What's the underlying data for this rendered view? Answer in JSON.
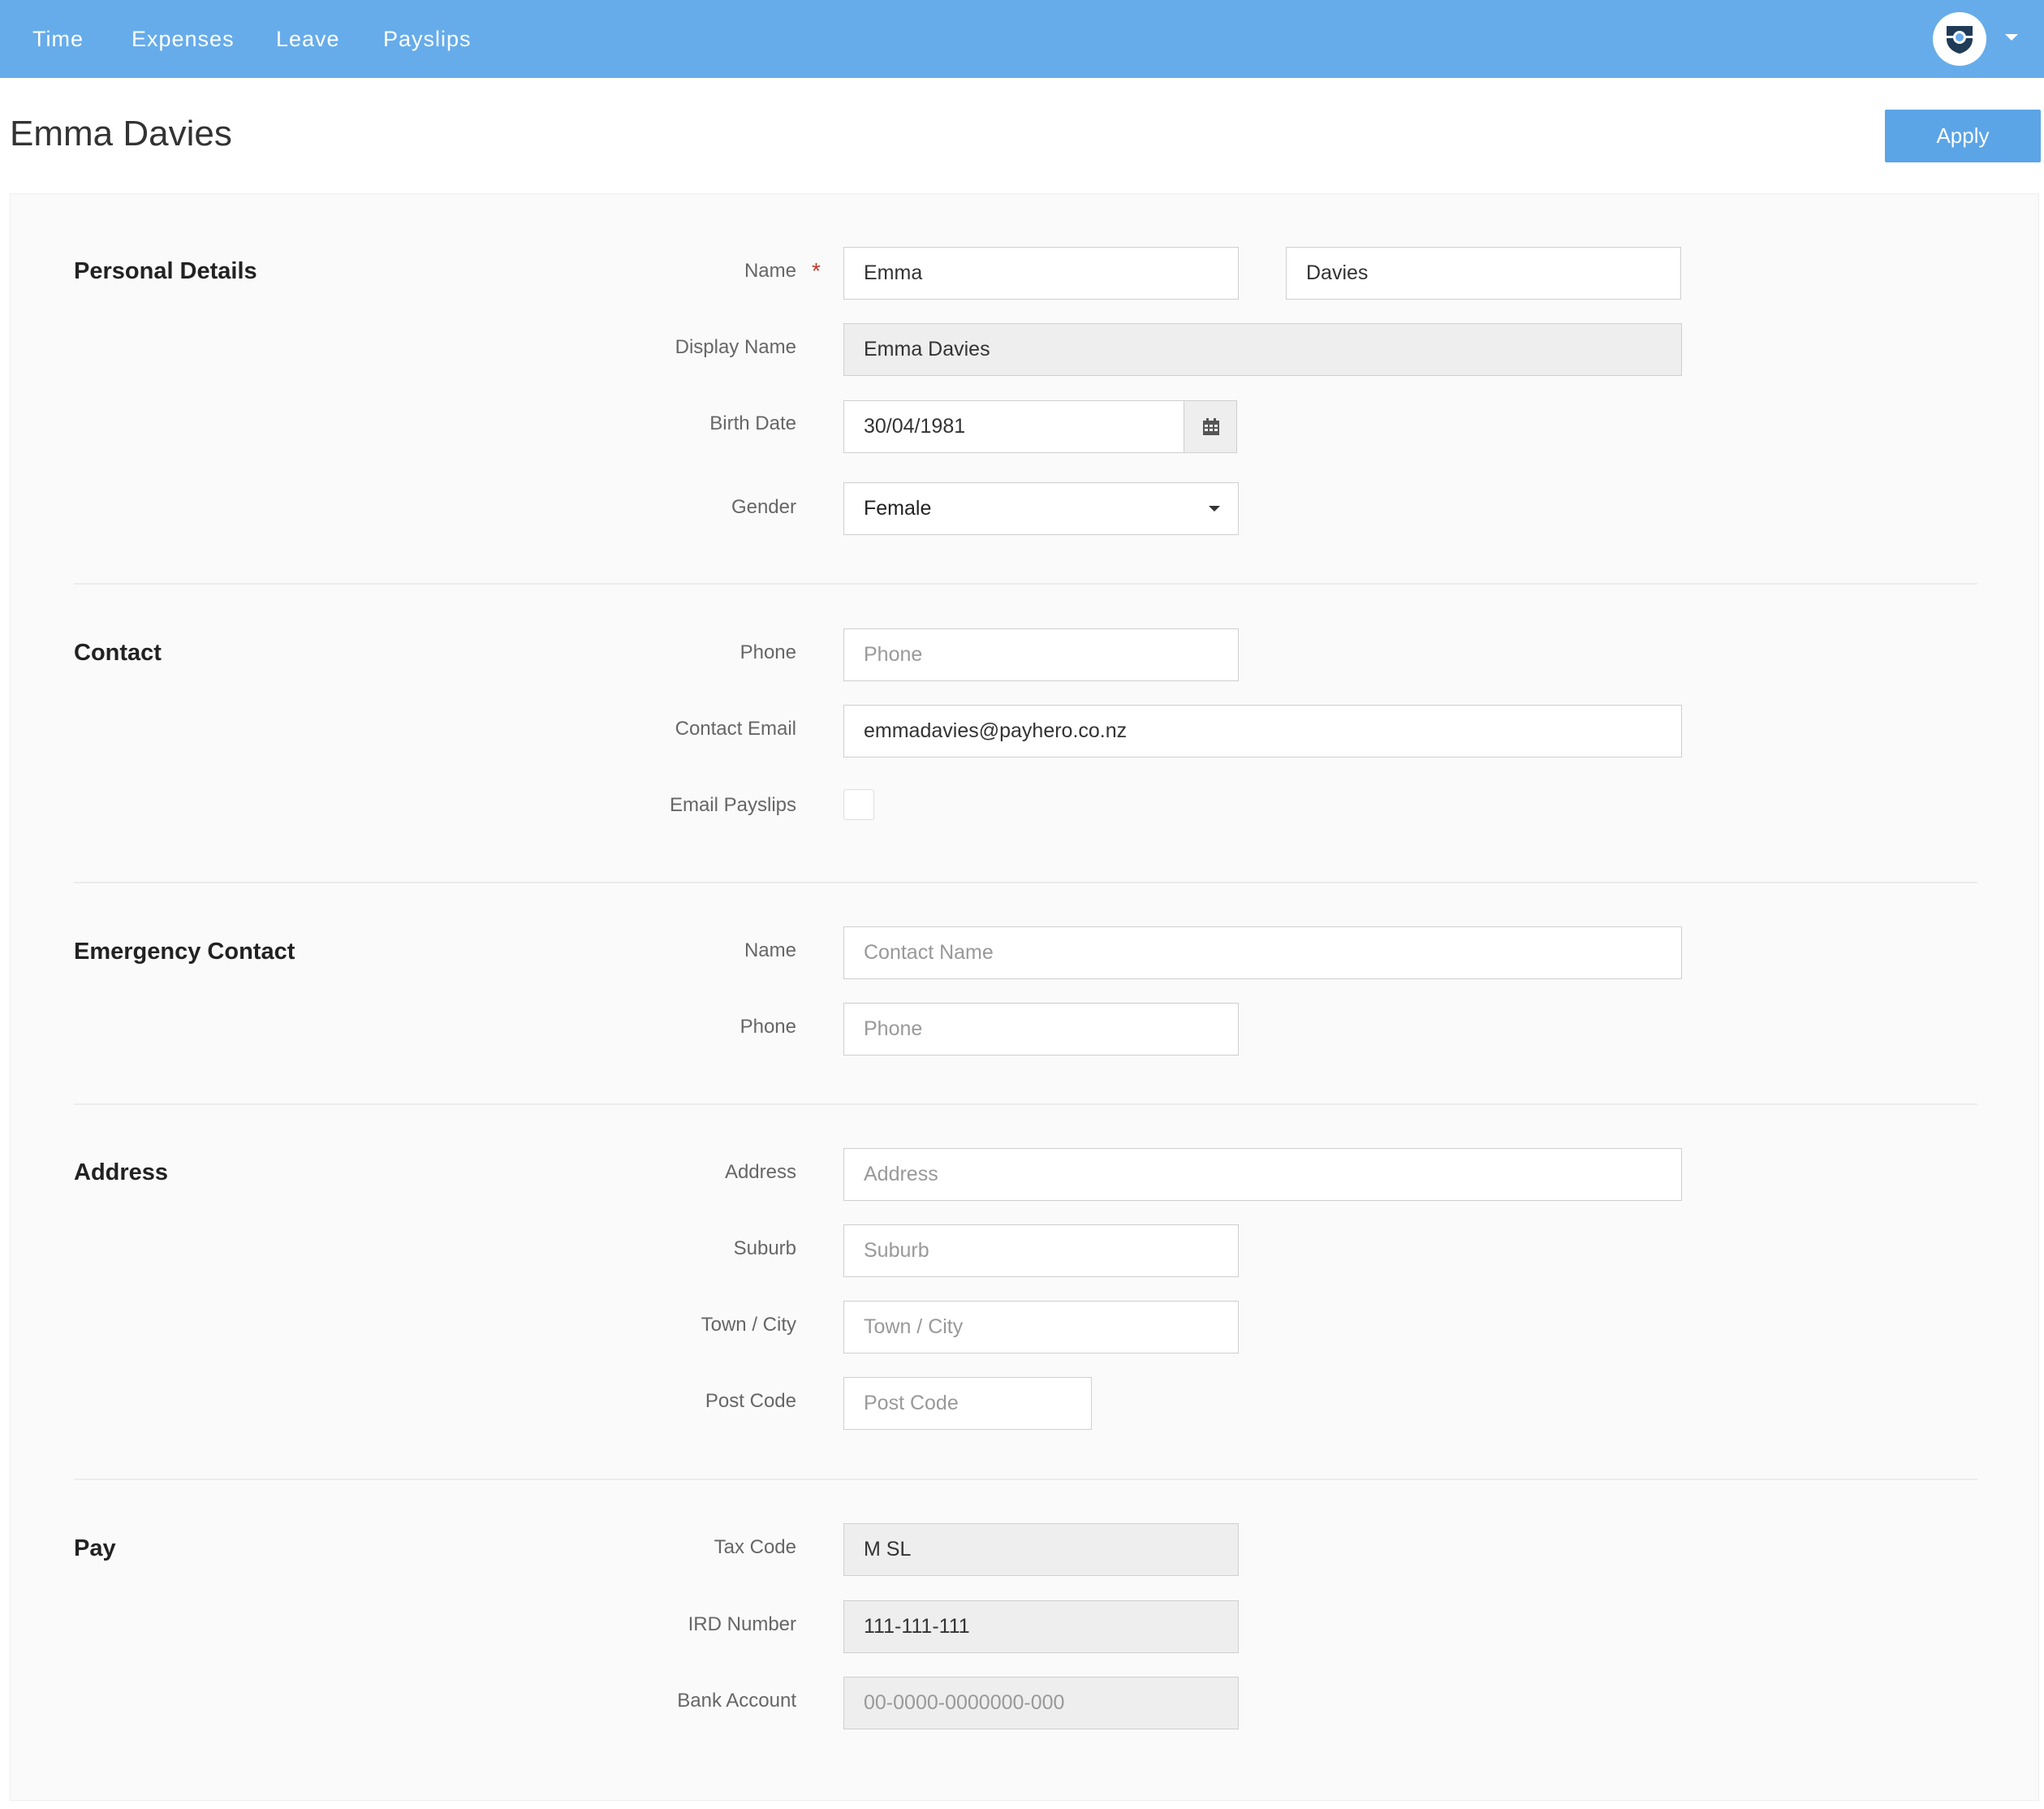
{
  "nav": {
    "items": [
      {
        "label": "Time"
      },
      {
        "label": "Expenses"
      },
      {
        "label": "Leave"
      },
      {
        "label": "Payslips"
      }
    ],
    "avatar_icon": "user-shield-icon",
    "accent": "#66acea"
  },
  "header": {
    "title": "Emma Davies",
    "apply_label": "Apply"
  },
  "personal": {
    "title": "Personal Details",
    "name_label": "Name",
    "required_mark": "*",
    "first_name": "Emma",
    "last_name": "Davies",
    "display_name_label": "Display Name",
    "display_name": "Emma Davies",
    "birth_date_label": "Birth Date",
    "birth_date": "30/04/1981",
    "calendar_icon": "calendar-icon",
    "gender_label": "Gender",
    "gender": "Female"
  },
  "contact": {
    "title": "Contact",
    "phone_label": "Phone",
    "phone_placeholder": "Phone",
    "email_label": "Contact Email",
    "email": "emmadavies@payhero.co.nz",
    "email_payslips_label": "Email Payslips",
    "email_payslips_checked": false
  },
  "emergency": {
    "title": "Emergency Contact",
    "name_label": "Name",
    "name_placeholder": "Contact Name",
    "phone_label": "Phone",
    "phone_placeholder": "Phone"
  },
  "address": {
    "title": "Address",
    "address_label": "Address",
    "address_placeholder": "Address",
    "suburb_label": "Suburb",
    "suburb_placeholder": "Suburb",
    "city_label": "Town / City",
    "city_placeholder": "Town / City",
    "postcode_label": "Post Code",
    "postcode_placeholder": "Post Code"
  },
  "pay": {
    "title": "Pay",
    "tax_code_label": "Tax Code",
    "tax_code": "M SL",
    "ird_label": "IRD Number",
    "ird": "111-111-111",
    "bank_label": "Bank Account",
    "bank": "00-0000-0000000-000"
  }
}
